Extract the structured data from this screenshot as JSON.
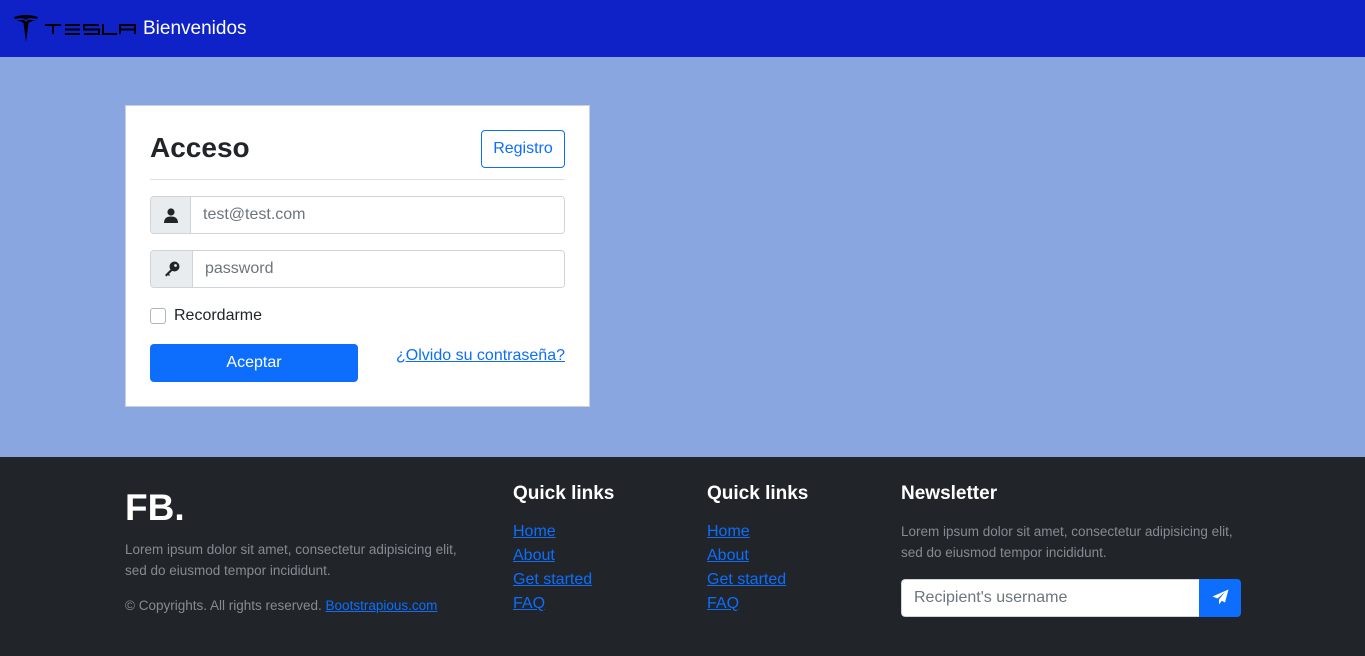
{
  "navbar": {
    "brand_wordmark": "TESLA",
    "brand_title": "Bienvenidos",
    "logo_icon": "tesla-logo-icon"
  },
  "login": {
    "title": "Acceso",
    "register_label": "Registro",
    "email": {
      "placeholder": "test@test.com",
      "value": "",
      "icon": "user-icon"
    },
    "password": {
      "placeholder": "password",
      "value": "",
      "icon": "key-icon"
    },
    "remember_label": "Recordarme",
    "remember_checked": false,
    "submit_label": "Aceptar",
    "forgot_label": "¿Olvido su contraseña?"
  },
  "footer": {
    "logo": "FB.",
    "description": "Lorem ipsum dolor sit amet, consectetur adipisicing elit, sed do eiusmod tempor incididunt.",
    "copyright_prefix": "© Copyrights. All rights reserved.",
    "copyright_link": "Bootstrapious.com",
    "columns": [
      {
        "heading": "Quick links",
        "links": [
          "Home",
          "About",
          "Get started",
          "FAQ"
        ]
      },
      {
        "heading": "Quick links",
        "links": [
          "Home",
          "About",
          "Get started",
          "FAQ"
        ]
      }
    ],
    "newsletter": {
      "heading": "Newsletter",
      "description": "Lorem ipsum dolor sit amet, consectetur adipisicing elit, sed do eiusmod tempor incididunt.",
      "placeholder": "Recipient's username",
      "button_icon": "paper-plane-icon"
    }
  },
  "colors": {
    "navbar": "#0e22c8",
    "page_background": "#89a6e1",
    "primary": "#0d6efd",
    "footer": "#212529"
  }
}
